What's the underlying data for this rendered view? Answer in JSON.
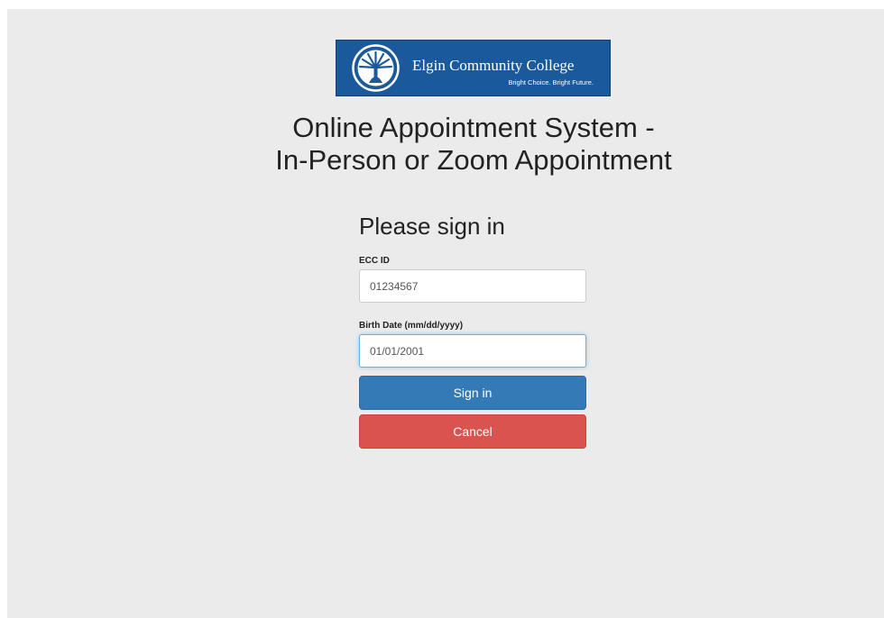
{
  "logo": {
    "name": "Elgin Community College",
    "tagline": "Bright Choice. Bright Future."
  },
  "title": {
    "line1": "Online Appointment System -",
    "line2": "In-Person or Zoom Appointment"
  },
  "signin": {
    "heading": "Please sign in",
    "ecc_id": {
      "label": "ECC ID",
      "value": "01234567"
    },
    "birth_date": {
      "label": "Birth Date (mm/dd/yyyy)",
      "value": "01/01/2001"
    },
    "signin_label": "Sign in",
    "cancel_label": "Cancel"
  },
  "colors": {
    "background": "#ebebeb",
    "logo_blue": "#1a5a9c",
    "primary_button": "#337ab7",
    "danger_button": "#d9534f"
  }
}
